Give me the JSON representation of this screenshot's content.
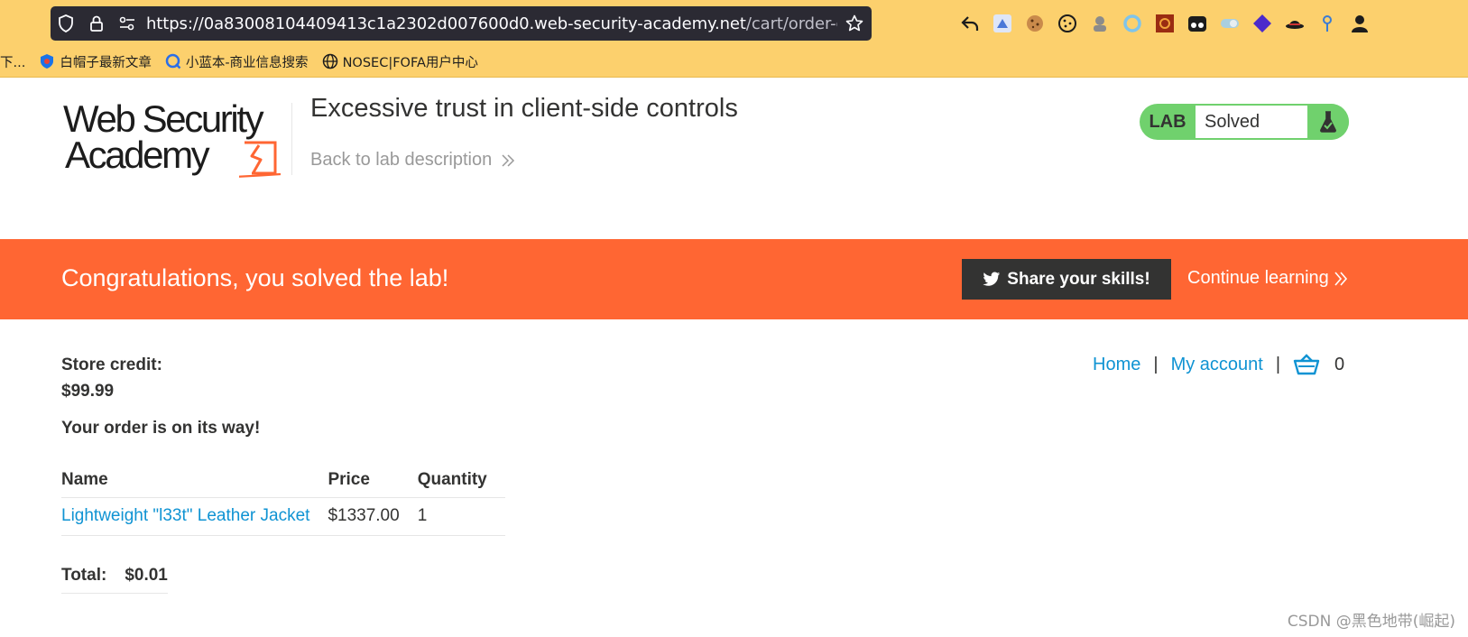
{
  "browser": {
    "url_main": "https://0a83008104409413c1a2302d007600d0.web-security-academy.net",
    "url_path": "/cart/order-confirm",
    "extensions": [
      "back-arrow-icon",
      "bird-extension-icon",
      "cookie-editor-icon",
      "cookie-icon",
      "spy-extension-icon",
      "ring-extension-icon",
      "gear-extension-icon",
      "glasses-extension-icon",
      "toggle-extension-icon",
      "diamond-extension-icon",
      "hat-extension-icon",
      "pin-extension-icon",
      "user-extension-icon"
    ],
    "bookmarks": [
      {
        "label": "下...",
        "icon": "none"
      },
      {
        "label": "白帽子最新文章",
        "icon": "shield-bookmark-icon"
      },
      {
        "label": "小蓝本-商业信息搜索",
        "icon": "q-bookmark-icon"
      },
      {
        "label": "NOSEC|FOFA用户中心",
        "icon": "globe-bookmark-icon"
      }
    ]
  },
  "header": {
    "logo_line1": "Web Security",
    "logo_line2": "Academy",
    "title": "Excessive trust in client-side controls",
    "back_link": "Back to lab description",
    "lab_tag": "LAB",
    "lab_status": "Solved"
  },
  "banner": {
    "title": "Congratulations, you solved the lab!",
    "share_label": "Share your skills!",
    "continue_label": "Continue learning"
  },
  "nav": {
    "home": "Home",
    "separator": "|",
    "my_account": "My account",
    "cart_count": "0"
  },
  "account": {
    "credit_label": "Store credit:",
    "credit_value": "$99.99",
    "order_message": "Your order is on its way!"
  },
  "order": {
    "columns": [
      "Name",
      "Price",
      "Quantity"
    ],
    "rows": [
      {
        "name": "Lightweight \"l33t\" Leather Jacket",
        "price": "$1337.00",
        "quantity": "1"
      }
    ],
    "total_label": "Total:",
    "total_value": "$0.01"
  },
  "watermark": "CSDN @黑色地带(崛起)",
  "colors": {
    "chrome": "#fcd06d",
    "banner": "#ff6633",
    "link": "#0f93d3",
    "solved": "#70d16d",
    "text": "#333332"
  }
}
